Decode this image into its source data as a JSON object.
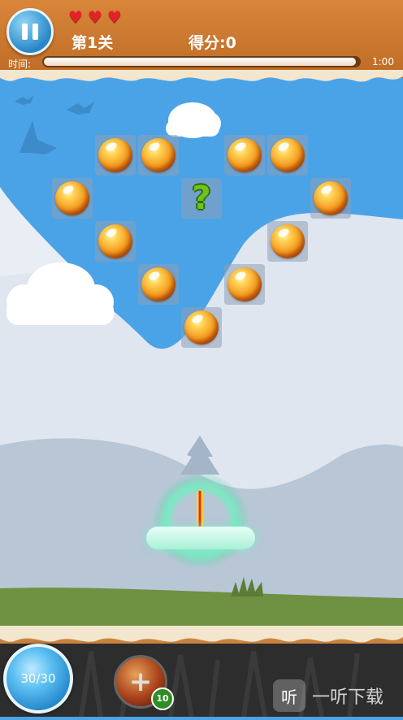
{
  "hud": {
    "lives": 3,
    "heart_glyph": "♥",
    "level_label": "第1关",
    "score_label": "得分:",
    "score_value": "0",
    "timer_label": "时间:",
    "timer_value": "1:00",
    "timer_fraction": 0.99
  },
  "board": {
    "cells": [
      {
        "row": 0,
        "col": 1,
        "type": "orb"
      },
      {
        "row": 0,
        "col": 2,
        "type": "orb"
      },
      {
        "row": 0,
        "col": 4,
        "type": "orb"
      },
      {
        "row": 0,
        "col": 5,
        "type": "orb"
      },
      {
        "row": 1,
        "col": 0,
        "type": "orb"
      },
      {
        "row": 1,
        "col": 3,
        "type": "question",
        "label": "?"
      },
      {
        "row": 1,
        "col": 6,
        "type": "orb"
      },
      {
        "row": 2,
        "col": 1,
        "type": "orb"
      },
      {
        "row": 2,
        "col": 5,
        "type": "orb"
      },
      {
        "row": 3,
        "col": 2,
        "type": "orb"
      },
      {
        "row": 3,
        "col": 4,
        "type": "orb"
      },
      {
        "row": 4,
        "col": 3,
        "type": "orb"
      }
    ]
  },
  "bottom": {
    "ammo_label": "30/30",
    "powerup_glyph": "+",
    "powerup_count": "10",
    "watermark_text": "一听下载",
    "watermark_icon": "听"
  },
  "colors": {
    "sky": "#4aa3e6",
    "hud_brown": "#c7742d",
    "hill_light": "#dfe6f0",
    "grass": "#6e9142"
  }
}
